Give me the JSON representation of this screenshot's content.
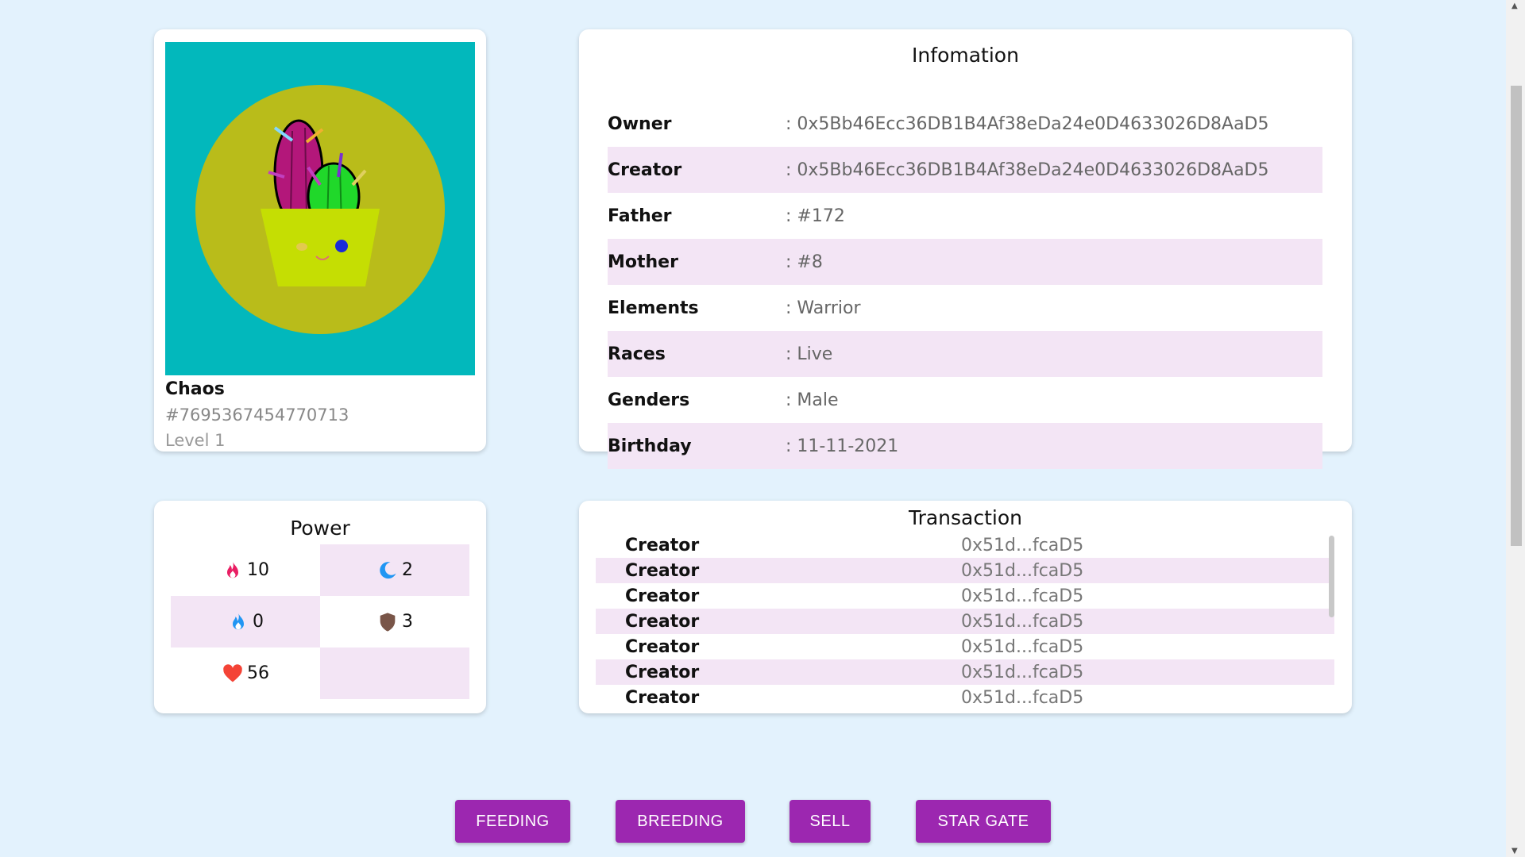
{
  "nft": {
    "name": "Chaos",
    "id": "#7695367454770713",
    "level": "Level 1",
    "colors": {
      "background": "#02b8bc",
      "circle": "#b9bc1a",
      "pot": "#c5de03"
    }
  },
  "information": {
    "title": "Infomation",
    "rows": [
      {
        "label": "Owner",
        "value": ": 0x5Bb46Ecc36DB1B4Af38eDa24e0D4633026D8AaD5"
      },
      {
        "label": "Creator",
        "value": ": 0x5Bb46Ecc36DB1B4Af38eDa24e0D4633026D8AaD5"
      },
      {
        "label": "Father",
        "value": ": #172"
      },
      {
        "label": "Mother",
        "value": ": #8"
      },
      {
        "label": "Elements",
        "value": ": Warrior"
      },
      {
        "label": "Races",
        "value": ": Live"
      },
      {
        "label": "Genders",
        "value": ": Male"
      },
      {
        "label": "Birthday",
        "value": ": 11-11-2021"
      }
    ]
  },
  "power": {
    "title": "Power",
    "stats": [
      {
        "icon": "fire-icon",
        "value": "10"
      },
      {
        "icon": "moon-icon",
        "value": "2"
      },
      {
        "icon": "water-flame-icon",
        "value": "0"
      },
      {
        "icon": "shield-icon",
        "value": "3"
      },
      {
        "icon": "heart-icon",
        "value": "56"
      }
    ]
  },
  "transaction": {
    "title": "Transaction",
    "rows": [
      {
        "type": "Creator",
        "address": "0x51d...fcaD5"
      },
      {
        "type": "Creator",
        "address": "0x51d...fcaD5"
      },
      {
        "type": "Creator",
        "address": "0x51d...fcaD5"
      },
      {
        "type": "Creator",
        "address": "0x51d...fcaD5"
      },
      {
        "type": "Creator",
        "address": "0x51d...fcaD5"
      },
      {
        "type": "Creator",
        "address": "0x51d...fcaD5"
      },
      {
        "type": "Creator",
        "address": "0x51d...fcaD5"
      }
    ]
  },
  "actions": {
    "feeding": "FEEDING",
    "breeding": "BREEDING",
    "sell": "SELL",
    "star_gate": "STAR GATE"
  },
  "colors": {
    "page_background": "#e3f2fd",
    "row_highlight": "#f3e5f5",
    "button": "#9c27b0"
  }
}
